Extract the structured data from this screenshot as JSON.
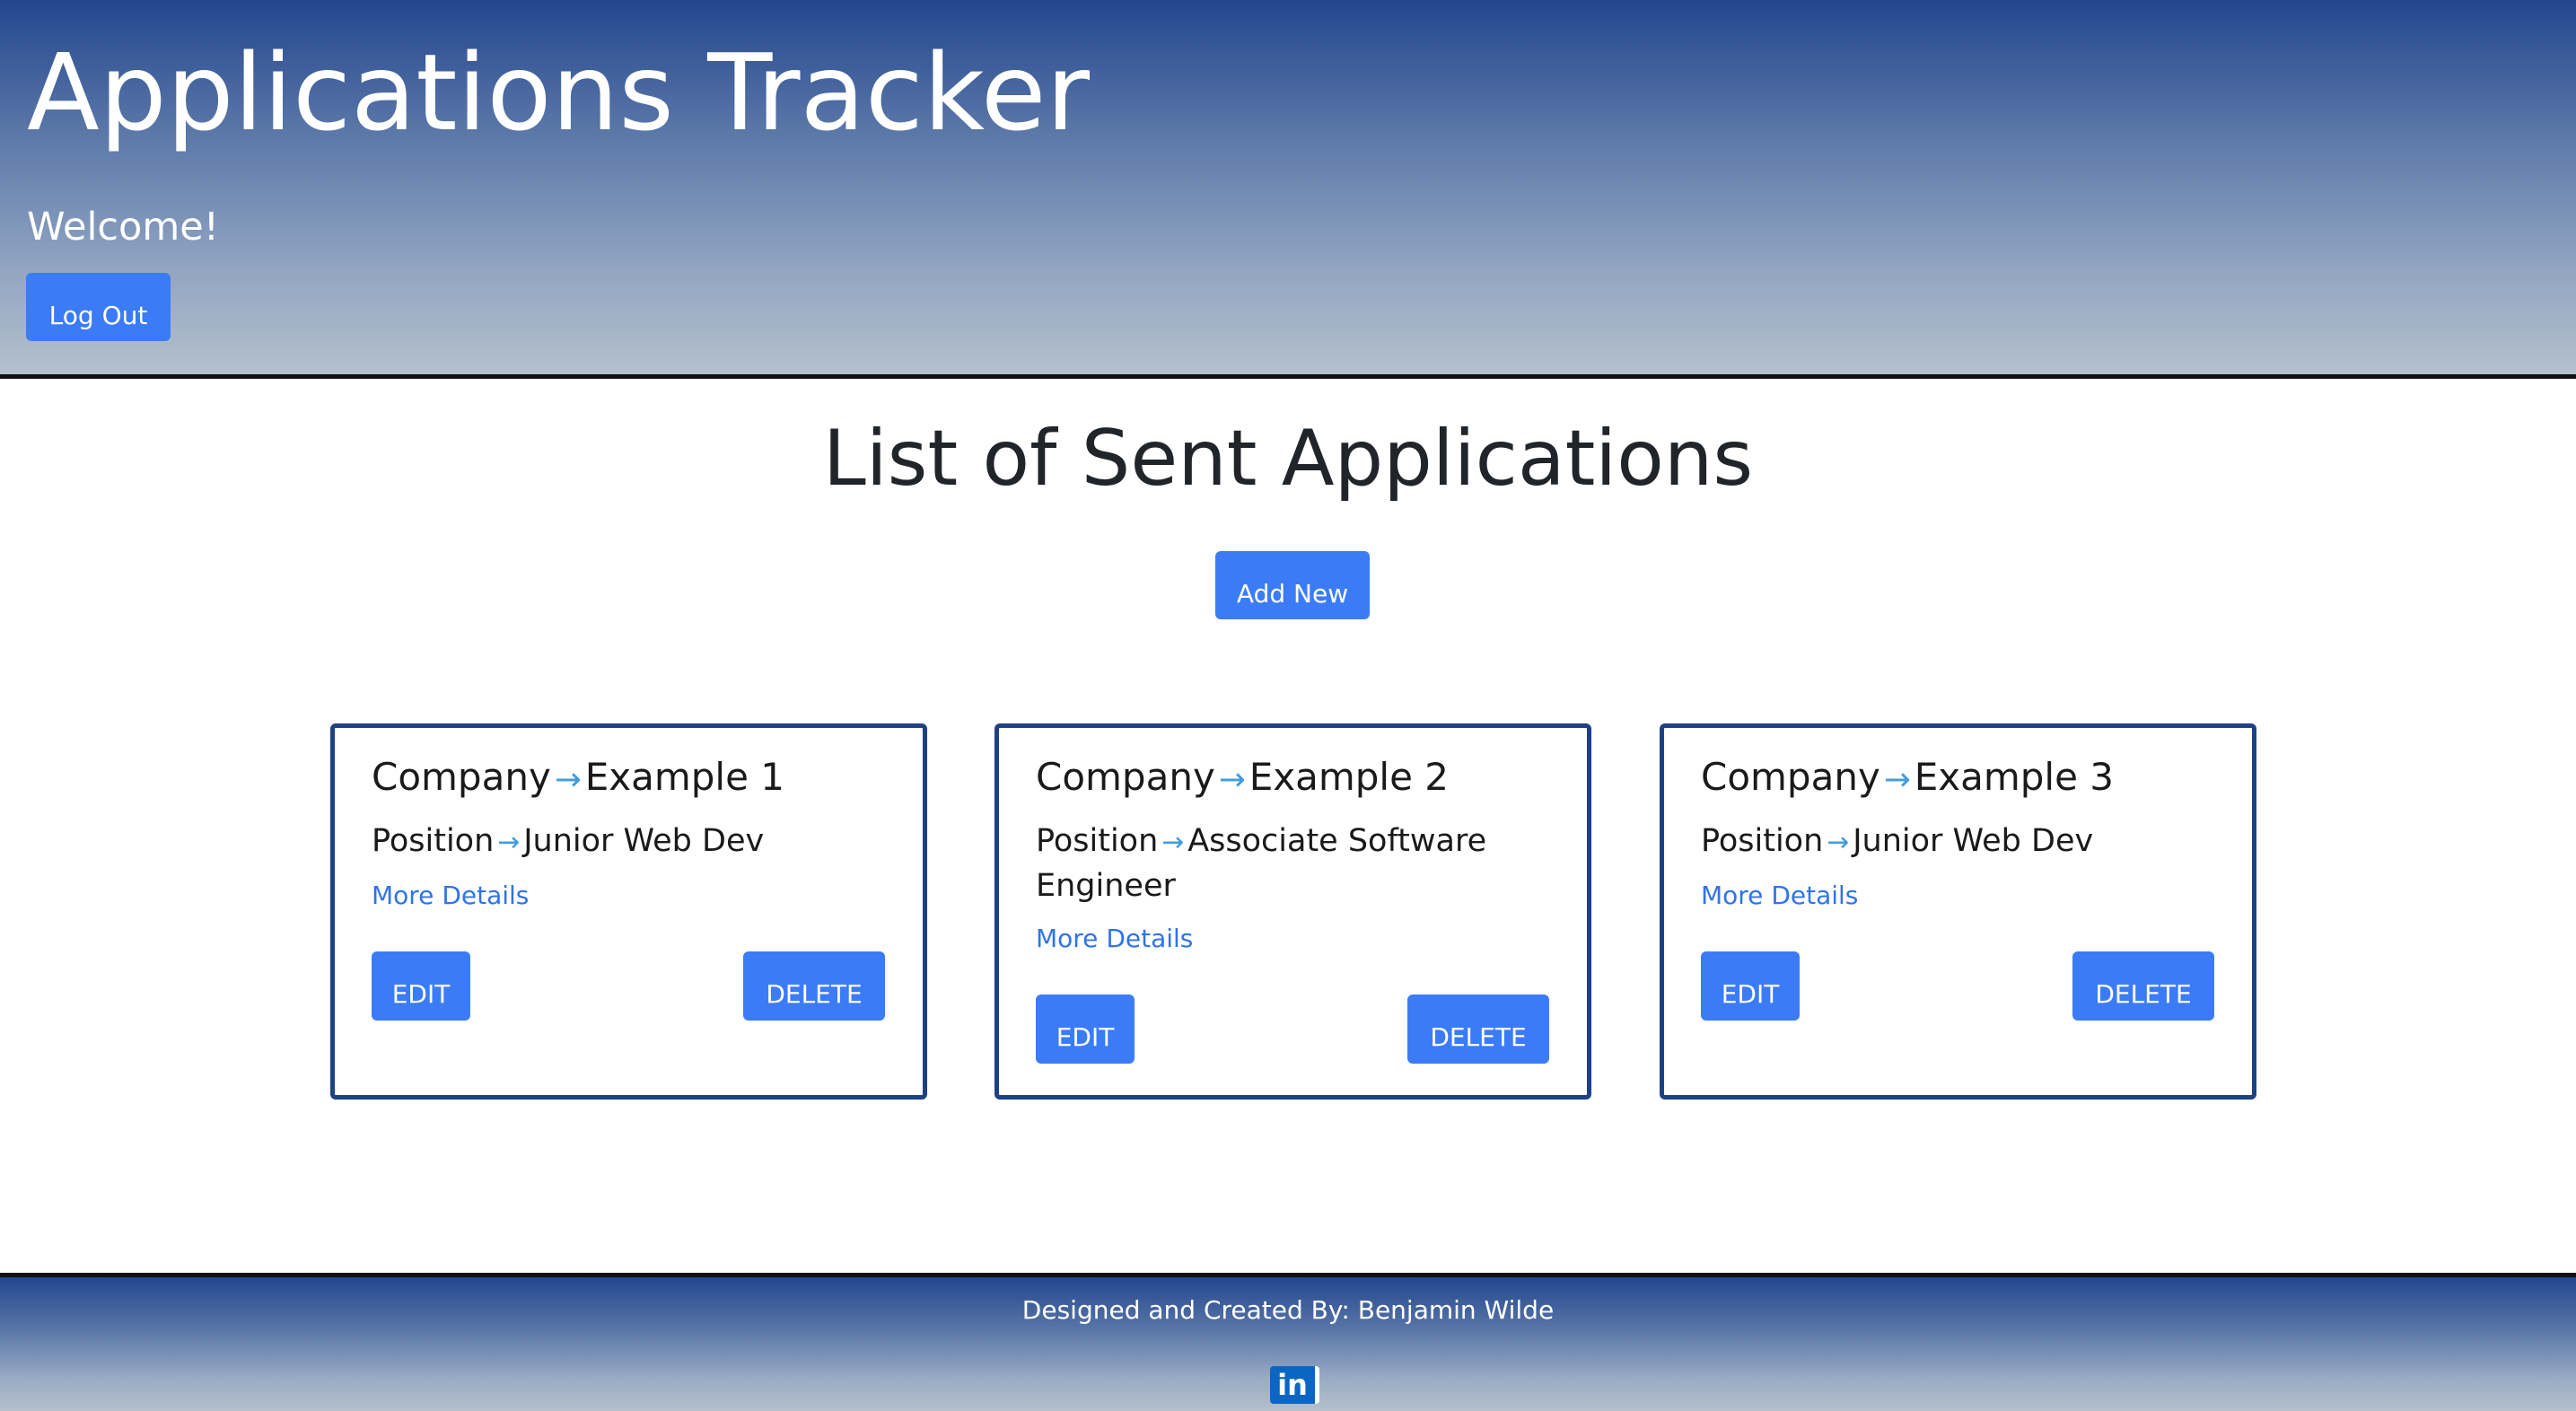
{
  "header": {
    "title": "Applications Tracker",
    "welcome": "Welcome!",
    "logout_label": "Log Out"
  },
  "main": {
    "title": "List of Sent Applications",
    "add_label": "Add New",
    "cards": [
      {
        "company_label": "Company",
        "company": "Example 1",
        "position_label": "Position",
        "position": "Junior Web Dev",
        "details_label": "More Details",
        "edit_label": "EDIT",
        "delete_label": "DELETE"
      },
      {
        "company_label": "Company",
        "company": "Example 2",
        "position_label": "Position",
        "position": "Associate Software Engineer",
        "details_label": "More Details",
        "edit_label": "EDIT",
        "delete_label": "DELETE"
      },
      {
        "company_label": "Company",
        "company": "Example 3",
        "position_label": "Position",
        "position": "Junior Web Dev",
        "details_label": "More Details",
        "edit_label": "EDIT",
        "delete_label": "DELETE"
      }
    ]
  },
  "footer": {
    "credit": "Designed and Created By: Benjamin Wilde",
    "social_icon": "linkedin-icon",
    "social_glyph": "in"
  },
  "colors": {
    "accent": "#3b7cf6",
    "card_border": "#1d4186",
    "link": "#2f74e8",
    "arrow": "#3f9de0"
  },
  "icons": {
    "arrow": "→"
  }
}
